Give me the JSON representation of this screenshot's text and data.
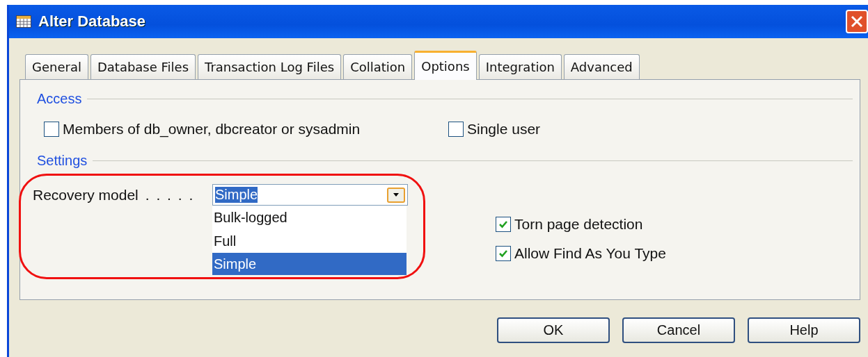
{
  "window": {
    "title": "Alter Database"
  },
  "tabs": [
    {
      "label": "General",
      "selected": false
    },
    {
      "label": "Database Files",
      "selected": false
    },
    {
      "label": "Transaction Log Files",
      "selected": false
    },
    {
      "label": "Collation",
      "selected": false
    },
    {
      "label": "Options",
      "selected": true
    },
    {
      "label": "Integration",
      "selected": false
    },
    {
      "label": "Advanced",
      "selected": false
    }
  ],
  "access": {
    "heading": "Access",
    "options": [
      {
        "label": "Members of db_owner, dbcreator or sysadmin",
        "checked": false
      },
      {
        "label": "Single user",
        "checked": false
      }
    ]
  },
  "settings": {
    "heading": "Settings",
    "recovery_model": {
      "label": "Recovery model",
      "leader": ". . . . .",
      "value": "Simple",
      "expanded": true,
      "options": [
        {
          "label": "Bulk-logged",
          "selected": false
        },
        {
          "label": "Full",
          "selected": false
        },
        {
          "label": "Simple",
          "selected": true
        }
      ]
    },
    "right_options": [
      {
        "label": "Torn page detection",
        "checked": true
      },
      {
        "label": "Allow Find As You Type",
        "checked": true
      }
    ]
  },
  "buttons": [
    "OK",
    "Cancel",
    "Help"
  ]
}
